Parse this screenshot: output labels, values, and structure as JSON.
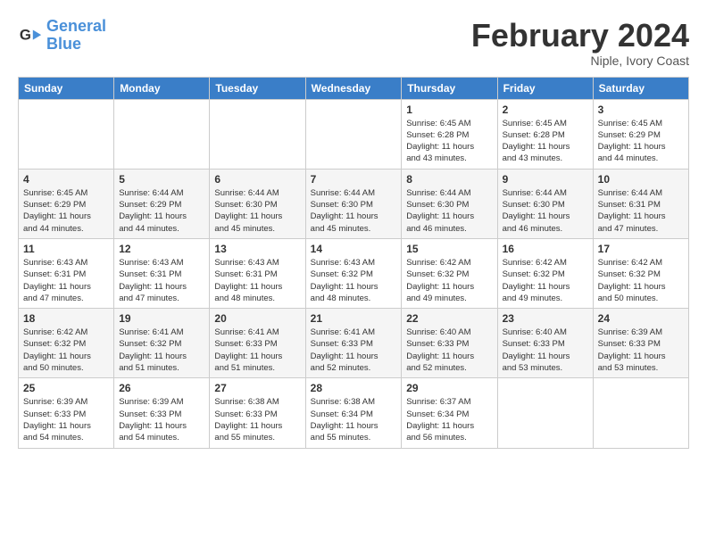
{
  "header": {
    "logo_line1": "General",
    "logo_line2": "Blue",
    "month": "February 2024",
    "location": "Niple, Ivory Coast"
  },
  "days_of_week": [
    "Sunday",
    "Monday",
    "Tuesday",
    "Wednesday",
    "Thursday",
    "Friday",
    "Saturday"
  ],
  "weeks": [
    [
      {
        "day": "",
        "info": ""
      },
      {
        "day": "",
        "info": ""
      },
      {
        "day": "",
        "info": ""
      },
      {
        "day": "",
        "info": ""
      },
      {
        "day": "1",
        "info": "Sunrise: 6:45 AM\nSunset: 6:28 PM\nDaylight: 11 hours\nand 43 minutes."
      },
      {
        "day": "2",
        "info": "Sunrise: 6:45 AM\nSunset: 6:28 PM\nDaylight: 11 hours\nand 43 minutes."
      },
      {
        "day": "3",
        "info": "Sunrise: 6:45 AM\nSunset: 6:29 PM\nDaylight: 11 hours\nand 44 minutes."
      }
    ],
    [
      {
        "day": "4",
        "info": "Sunrise: 6:45 AM\nSunset: 6:29 PM\nDaylight: 11 hours\nand 44 minutes."
      },
      {
        "day": "5",
        "info": "Sunrise: 6:44 AM\nSunset: 6:29 PM\nDaylight: 11 hours\nand 44 minutes."
      },
      {
        "day": "6",
        "info": "Sunrise: 6:44 AM\nSunset: 6:30 PM\nDaylight: 11 hours\nand 45 minutes."
      },
      {
        "day": "7",
        "info": "Sunrise: 6:44 AM\nSunset: 6:30 PM\nDaylight: 11 hours\nand 45 minutes."
      },
      {
        "day": "8",
        "info": "Sunrise: 6:44 AM\nSunset: 6:30 PM\nDaylight: 11 hours\nand 46 minutes."
      },
      {
        "day": "9",
        "info": "Sunrise: 6:44 AM\nSunset: 6:30 PM\nDaylight: 11 hours\nand 46 minutes."
      },
      {
        "day": "10",
        "info": "Sunrise: 6:44 AM\nSunset: 6:31 PM\nDaylight: 11 hours\nand 47 minutes."
      }
    ],
    [
      {
        "day": "11",
        "info": "Sunrise: 6:43 AM\nSunset: 6:31 PM\nDaylight: 11 hours\nand 47 minutes."
      },
      {
        "day": "12",
        "info": "Sunrise: 6:43 AM\nSunset: 6:31 PM\nDaylight: 11 hours\nand 47 minutes."
      },
      {
        "day": "13",
        "info": "Sunrise: 6:43 AM\nSunset: 6:31 PM\nDaylight: 11 hours\nand 48 minutes."
      },
      {
        "day": "14",
        "info": "Sunrise: 6:43 AM\nSunset: 6:32 PM\nDaylight: 11 hours\nand 48 minutes."
      },
      {
        "day": "15",
        "info": "Sunrise: 6:42 AM\nSunset: 6:32 PM\nDaylight: 11 hours\nand 49 minutes."
      },
      {
        "day": "16",
        "info": "Sunrise: 6:42 AM\nSunset: 6:32 PM\nDaylight: 11 hours\nand 49 minutes."
      },
      {
        "day": "17",
        "info": "Sunrise: 6:42 AM\nSunset: 6:32 PM\nDaylight: 11 hours\nand 50 minutes."
      }
    ],
    [
      {
        "day": "18",
        "info": "Sunrise: 6:42 AM\nSunset: 6:32 PM\nDaylight: 11 hours\nand 50 minutes."
      },
      {
        "day": "19",
        "info": "Sunrise: 6:41 AM\nSunset: 6:32 PM\nDaylight: 11 hours\nand 51 minutes."
      },
      {
        "day": "20",
        "info": "Sunrise: 6:41 AM\nSunset: 6:33 PM\nDaylight: 11 hours\nand 51 minutes."
      },
      {
        "day": "21",
        "info": "Sunrise: 6:41 AM\nSunset: 6:33 PM\nDaylight: 11 hours\nand 52 minutes."
      },
      {
        "day": "22",
        "info": "Sunrise: 6:40 AM\nSunset: 6:33 PM\nDaylight: 11 hours\nand 52 minutes."
      },
      {
        "day": "23",
        "info": "Sunrise: 6:40 AM\nSunset: 6:33 PM\nDaylight: 11 hours\nand 53 minutes."
      },
      {
        "day": "24",
        "info": "Sunrise: 6:39 AM\nSunset: 6:33 PM\nDaylight: 11 hours\nand 53 minutes."
      }
    ],
    [
      {
        "day": "25",
        "info": "Sunrise: 6:39 AM\nSunset: 6:33 PM\nDaylight: 11 hours\nand 54 minutes."
      },
      {
        "day": "26",
        "info": "Sunrise: 6:39 AM\nSunset: 6:33 PM\nDaylight: 11 hours\nand 54 minutes."
      },
      {
        "day": "27",
        "info": "Sunrise: 6:38 AM\nSunset: 6:33 PM\nDaylight: 11 hours\nand 55 minutes."
      },
      {
        "day": "28",
        "info": "Sunrise: 6:38 AM\nSunset: 6:34 PM\nDaylight: 11 hours\nand 55 minutes."
      },
      {
        "day": "29",
        "info": "Sunrise: 6:37 AM\nSunset: 6:34 PM\nDaylight: 11 hours\nand 56 minutes."
      },
      {
        "day": "",
        "info": ""
      },
      {
        "day": "",
        "info": ""
      }
    ]
  ]
}
